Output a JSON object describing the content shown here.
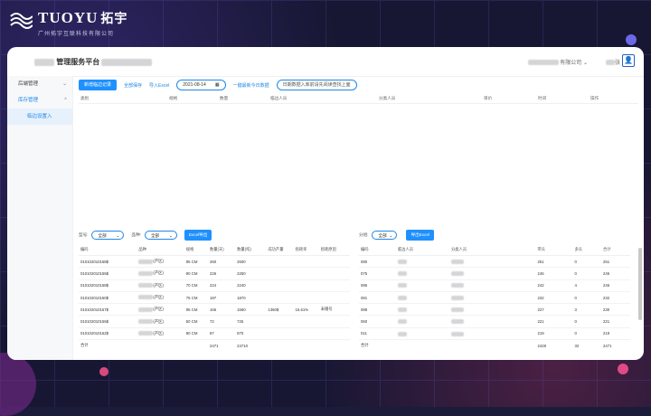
{
  "logo": {
    "brand": "TUOYU",
    "brand_cn": "拓宇",
    "sub": "广州拓宇互联科技有限公司"
  },
  "app": {
    "title": "管理服务平台"
  },
  "header": {
    "company": "有限公司",
    "user": "张"
  },
  "sidebar": {
    "groups": [
      {
        "label": "后端管理"
      },
      {
        "label": "库存管理"
      }
    ],
    "sub_item": "临边设置入"
  },
  "toolbar": {
    "new_label": "新增临边记录",
    "all_label": "全部保存",
    "import_label": "导入Excel",
    "date": "2021-08-14",
    "latest_label": "一键最新今日数据",
    "pill_label": "日期数据入库前请先阅读查找上面"
  },
  "upper_table": {
    "headers": [
      "类别",
      "规格",
      "数量",
      "临边人员",
      "分类人员",
      "单价",
      "时间",
      "操作"
    ]
  },
  "left_panel": {
    "filter1_label": "型号:",
    "filter1_value": "全部",
    "filter2_label": "品种:",
    "filter2_value": "全部",
    "excel_label": "Excel导出",
    "headers": [
      "编码",
      "品种",
      "规格",
      "数量(天)",
      "数量(吨)",
      "成功产量",
      "损耗率",
      "损耗原因"
    ],
    "rows": [
      {
        "code": "010102010158$",
        "variety": "(产区)",
        "spec": "95 CM",
        "qty_day": "260",
        "qty_ton": "2600",
        "yield": "",
        "loss": "",
        "reason": ""
      },
      {
        "code": "010102010156$",
        "variety": "(产区)",
        "spec": "90 CM",
        "qty_day": "226",
        "qty_ton": "2250",
        "yield": "",
        "loss": "",
        "reason": ""
      },
      {
        "code": "010102010158$",
        "variety": "(产区)",
        "spec": "70 CM",
        "qty_day": "224",
        "qty_ton": "2240",
        "yield": "",
        "loss": "",
        "reason": ""
      },
      {
        "code": "010102010150$",
        "variety": "(产区)",
        "spec": "75 CM",
        "qty_day": "187",
        "qty_ton": "1870",
        "yield": "",
        "loss": "",
        "reason": ""
      },
      {
        "code": "010102010157$",
        "variety": "(产区)",
        "spec": "95 CM",
        "qty_day": "166",
        "qty_ton": "1660",
        "yield": "1360$",
        "loss": "16.61%",
        "reason": "未储号"
      },
      {
        "code": "010102010156$",
        "variety": "(产区)",
        "spec": "50 CM",
        "qty_day": "72",
        "qty_ton": "725",
        "yield": "",
        "loss": "",
        "reason": ""
      },
      {
        "code": "010102010152$",
        "variety": "(产区)",
        "spec": "80 CM",
        "qty_day": "87",
        "qty_ton": "870",
        "yield": "",
        "loss": "",
        "reason": ""
      }
    ],
    "total_label": "合计",
    "total_day": "2471",
    "total_ton": "24710"
  },
  "right_panel": {
    "filter_label": "分组:",
    "filter_value": "全部",
    "excel_label": "导出Excel",
    "headers": [
      "编码",
      "临边人员",
      "分类人员",
      "带头",
      "多头",
      "合计"
    ],
    "rows": [
      {
        "code": "080",
        "a": "251",
        "b": "0",
        "c": "251"
      },
      {
        "code": "075",
        "a": "246",
        "b": "0",
        "c": "246"
      },
      {
        "code": "086",
        "a": "242",
        "b": "4",
        "c": "246"
      },
      {
        "code": "081",
        "a": "232",
        "b": "0",
        "c": "232"
      },
      {
        "code": "088",
        "a": "227",
        "b": "3",
        "c": "230"
      },
      {
        "code": "060",
        "a": "221",
        "b": "0",
        "c": "221"
      },
      {
        "code": "011",
        "a": "219",
        "b": "0",
        "c": "219"
      }
    ],
    "total_label": "合计",
    "total_a": "2428",
    "total_b": "32",
    "total_c": "2471"
  }
}
